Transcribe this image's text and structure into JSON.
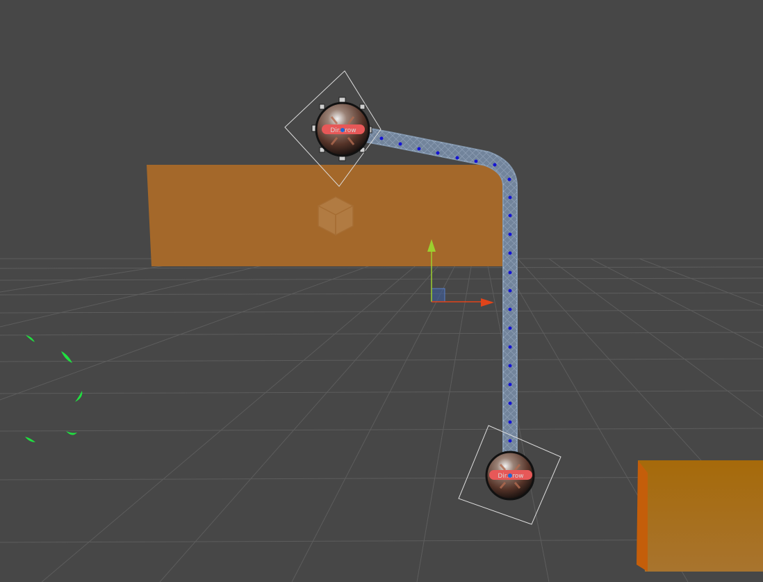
{
  "scene": {
    "background_color": "#474747",
    "grid_color": "#5c5c5c",
    "cube_color": "#a4682a",
    "cube_icon_color": "#b27a3e",
    "right_cube_color": "#a86a10",
    "rope_color": "#9fb3c8",
    "rope_node_color": "#1414d4",
    "gizmo": {
      "y_axis_color": "#9ccf2e",
      "x_axis_color": "#e0441a",
      "z_plane_color": "#3c5fa3"
    },
    "particles_color": "#20e040"
  },
  "lights": [
    {
      "name": "point-light-top",
      "label": "Dir...row",
      "icon": "point-light-icon"
    },
    {
      "name": "point-light-bottom",
      "label": "Dir...row",
      "icon": "point-light-icon"
    }
  ]
}
